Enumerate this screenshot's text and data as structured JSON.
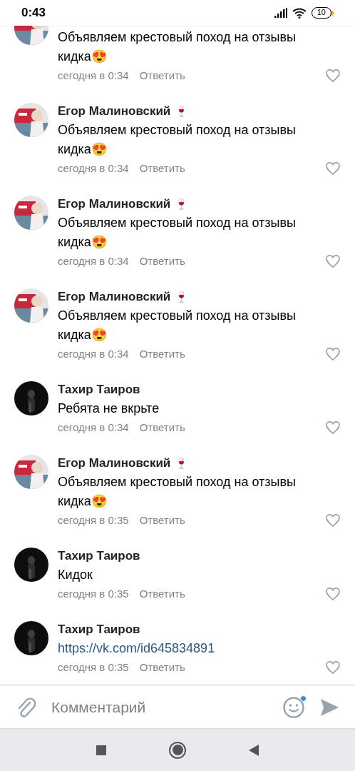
{
  "status_bar": {
    "time": "0:43",
    "battery": "10"
  },
  "comments": [
    {
      "text": "Объявляем крестовый поход на отзывы кидка😍",
      "time": "сегодня в 0:34",
      "reply": "Ответить",
      "liked": false,
      "is_link": false
    },
    {
      "name": "Егор Малиновский",
      "badge": "🍷",
      "text": "Объявляем крестовый поход на отзывы кидка😍",
      "time": "сегодня в 0:34",
      "reply": "Ответить",
      "liked": false,
      "is_link": false
    },
    {
      "name": "Егор Малиновский",
      "badge": "🍷",
      "text": "Объявляем крестовый поход на отзывы кидка😍",
      "time": "сегодня в 0:34",
      "reply": "Ответить",
      "liked": false,
      "is_link": false
    },
    {
      "name": "Егор Малиновский",
      "badge": "🍷",
      "text": "Объявляем крестовый поход на отзывы кидка😍",
      "time": "сегодня в 0:34",
      "reply": "Ответить",
      "liked": false,
      "is_link": false
    },
    {
      "name": "Тахир Таиров",
      "text": "Ребята не вкрьте",
      "time": "сегодня в 0:34",
      "reply": "Ответить",
      "liked": false,
      "is_link": false
    },
    {
      "name": "Егор Малиновский",
      "badge": "🍷",
      "text": "Объявляем крестовый поход на отзывы кидка😍",
      "time": "сегодня в 0:35",
      "reply": "Ответить",
      "liked": false,
      "is_link": false
    },
    {
      "name": "Тахир Таиров",
      "text": "Кидок",
      "time": "сегодня в 0:35",
      "reply": "Ответить",
      "liked": false,
      "is_link": false
    },
    {
      "name": "Тахир Таиров",
      "text": "https://vk.com/id645834891",
      "time": "сегодня в 0:35",
      "reply": "Ответить",
      "liked": false,
      "is_link": true
    }
  ],
  "composer": {
    "placeholder": "Комментарий",
    "emoji_notification": true
  }
}
